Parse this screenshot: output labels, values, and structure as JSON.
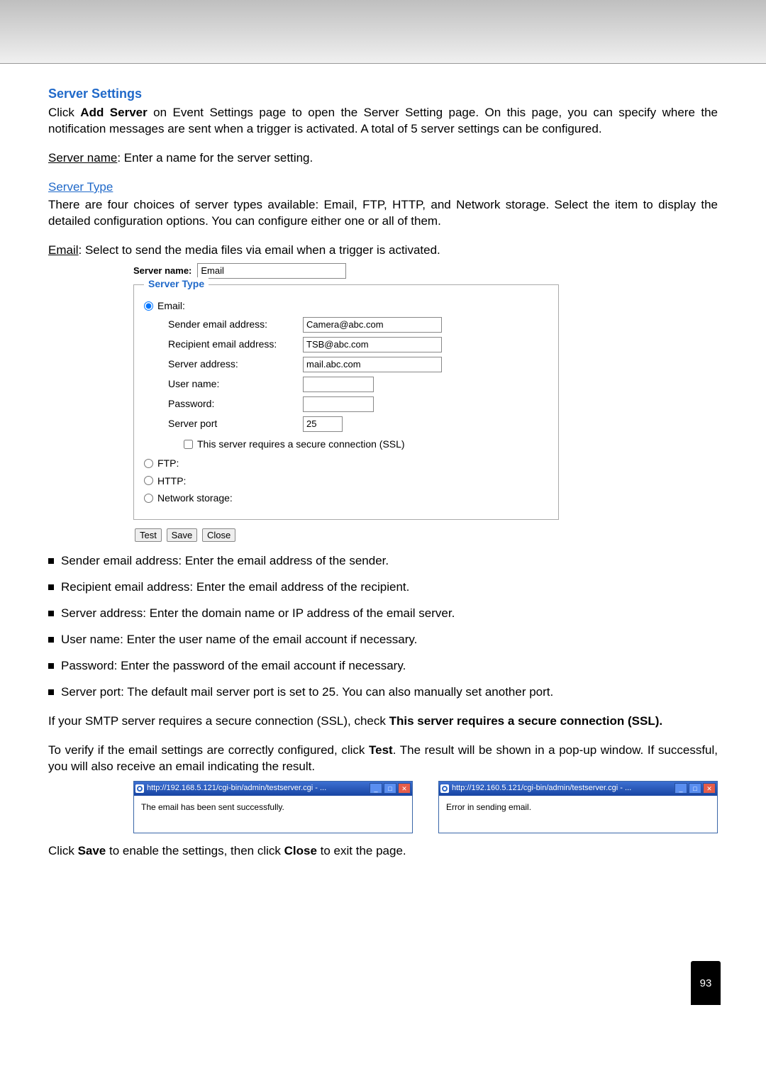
{
  "section_title": "Server Settings",
  "intro_p1_a": "Click ",
  "intro_p1_b": "Add Server",
  "intro_p1_c": " on Event Settings page to open the Server Setting page. On this page, you can specify where the notification messages are sent when a trigger is activated. A total of 5 server settings can be configured.",
  "server_name_label": "Server name",
  "server_name_desc": ": Enter a name for the server setting.",
  "server_type_link": "Server Type",
  "server_type_p": "There are four choices of server types available: Email, FTP, HTTP, and Network storage. Select the item to display the detailed configuration options. You can configure either one or all of them.",
  "email_label": "Email",
  "email_desc": ": Select to send the media files via email when a trigger is activated.",
  "screenshot": {
    "server_name_lbl": "Server name:",
    "server_name_val": "Email",
    "legend": "Server Type",
    "radio_email": "Email:",
    "fields": {
      "sender_lbl": "Sender email address:",
      "sender_val": "Camera@abc.com",
      "recipient_lbl": "Recipient email address:",
      "recipient_val": "TSB@abc.com",
      "server_addr_lbl": "Server address:",
      "server_addr_val": "mail.abc.com",
      "username_lbl": "User name:",
      "username_val": "",
      "password_lbl": "Password:",
      "password_val": "",
      "port_lbl": "Server port",
      "port_val": "25"
    },
    "ssl_label": "This server requires a secure connection (SSL)",
    "radio_ftp": "FTP:",
    "radio_http": "HTTP:",
    "radio_ns": "Network storage:",
    "btn_test": "Test",
    "btn_save": "Save",
    "btn_close": "Close"
  },
  "bullets": [
    "Sender email address: Enter the email address of the sender.",
    "Recipient email address: Enter the email address of the recipient.",
    "Server address: Enter the domain name or IP address of the email server.",
    "User name: Enter the user name of the email account if necessary.",
    "Password: Enter the password of the email account if necessary.",
    "Server port: The default mail server port is set to 25. You can also manually set another port."
  ],
  "ssl_para_a": "If your SMTP server requires a secure connection (SSL), check ",
  "ssl_para_b": "This server requires a secure connection (SSL).",
  "test_para_a": "To verify if the email settings are correctly configured, click ",
  "test_para_b": "Test",
  "test_para_c": ". The result will be shown in a pop-up window. If successful, you will also receive an email indicating the result.",
  "popup1": {
    "title": "http://192.168.5.121/cgi-bin/admin/testserver.cgi - ...",
    "body": "The email has been sent successfully."
  },
  "popup2": {
    "title": "http://192.160.5.121/cgi-bin/admin/testserver.cgi - ...",
    "body": "Error in sending email."
  },
  "save_close_a": "Click ",
  "save_close_b": "Save",
  "save_close_c": " to enable the settings, then click ",
  "save_close_d": "Close",
  "save_close_e": " to exit the page.",
  "page_number": "93"
}
